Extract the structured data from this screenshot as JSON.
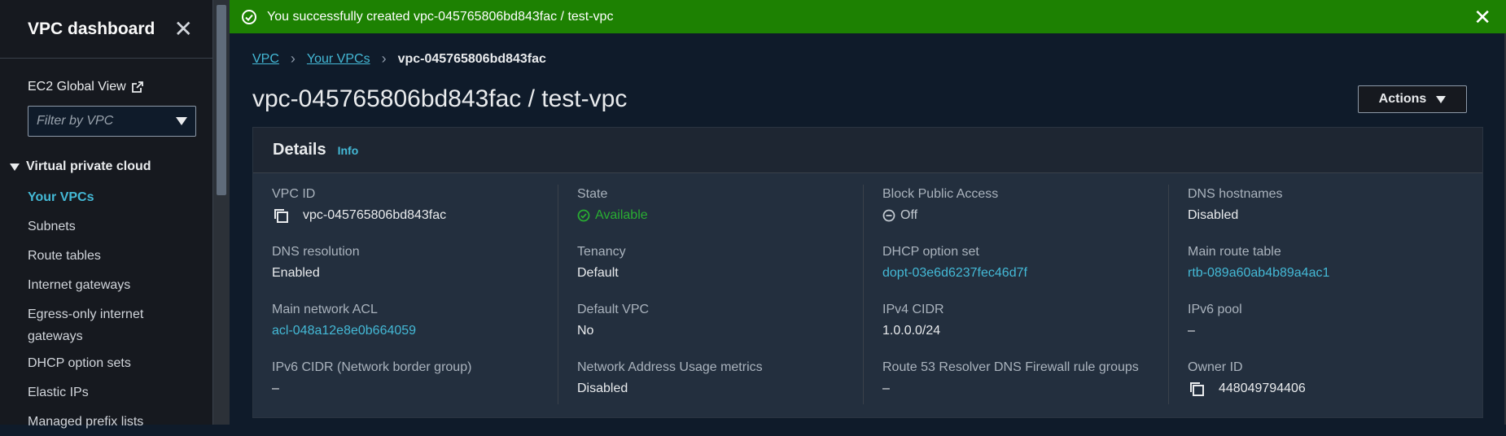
{
  "flash": {
    "message": "You successfully created vpc-045765806bd843fac / test-vpc",
    "color": "#1d8102"
  },
  "sidebar": {
    "title": "VPC dashboard",
    "global_view": "EC2 Global View",
    "filter_placeholder": "Filter by VPC",
    "section": "Virtual private cloud",
    "items": [
      {
        "label": "Your VPCs"
      },
      {
        "label": "Subnets"
      },
      {
        "label": "Route tables"
      },
      {
        "label": "Internet gateways"
      },
      {
        "label": "Egress-only internet gateways"
      },
      {
        "label": "DHCP option sets"
      },
      {
        "label": "Elastic IPs"
      },
      {
        "label": "Managed prefix lists"
      }
    ]
  },
  "breadcrumb": {
    "root": "VPC",
    "parent": "Your VPCs",
    "current": "vpc-045765806bd843fac"
  },
  "page": {
    "title": "vpc-045765806bd843fac / test-vpc",
    "actions_label": "Actions"
  },
  "details": {
    "title": "Details",
    "info": "Info",
    "col1": [
      {
        "label": "VPC ID",
        "value": "vpc-045765806bd843fac"
      },
      {
        "label": "DNS resolution",
        "value": "Enabled"
      },
      {
        "label": "Main network ACL",
        "value": "acl-048a12e8e0b664059"
      },
      {
        "label": "IPv6 CIDR (Network border group)",
        "value": "–"
      }
    ],
    "col2": [
      {
        "label": "State",
        "value": "Available"
      },
      {
        "label": "Tenancy",
        "value": "Default"
      },
      {
        "label": "Default VPC",
        "value": "No"
      },
      {
        "label": "Network Address Usage metrics",
        "value": "Disabled"
      }
    ],
    "col3": [
      {
        "label": "Block Public Access",
        "value": "Off"
      },
      {
        "label": "DHCP option set",
        "value": "dopt-03e6d6237fec46d7f"
      },
      {
        "label": "IPv4 CIDR",
        "value": "1.0.0.0/24"
      },
      {
        "label": "Route 53 Resolver DNS Firewall rule groups",
        "value": "–"
      }
    ],
    "col4": [
      {
        "label": "DNS hostnames",
        "value": "Disabled"
      },
      {
        "label": "Main route table",
        "value": "rtb-089a60ab4b89a4ac1"
      },
      {
        "label": "IPv6 pool",
        "value": "–"
      },
      {
        "label": "Owner ID",
        "value": "448049794406"
      }
    ]
  },
  "colors": {
    "link": "#44b9d6",
    "success": "#29ad32",
    "background": "#0f1b2a",
    "panel": "#232f3e"
  }
}
